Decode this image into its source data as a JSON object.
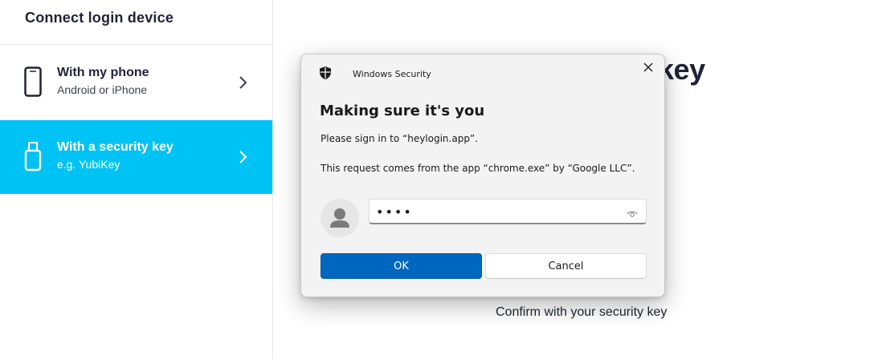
{
  "sidebar": {
    "title": "Connect login device",
    "options": [
      {
        "title": "With my phone",
        "subtitle": "Android or iPhone",
        "icon": "phone-icon",
        "selected": false
      },
      {
        "title": "With a security key",
        "subtitle": "e.g. YubiKey",
        "icon": "usb-key-icon",
        "selected": true
      }
    ]
  },
  "main": {
    "heading_fragment": "y key",
    "confirm_text": "Confirm with your security key"
  },
  "dialog": {
    "app_name": "Windows Security",
    "title": "Making sure it's you",
    "sign_in_text": "Please sign in to “heylogin.app”.",
    "request_text": "This request comes from the app “chrome.exe” by “Google LLC”.",
    "pin_value": "1234",
    "ok_label": "OK",
    "cancel_label": "Cancel"
  },
  "colors": {
    "selected_option_bg": "#00c3f5",
    "primary_button": "#0067c0",
    "heading_text": "#1f2337"
  }
}
